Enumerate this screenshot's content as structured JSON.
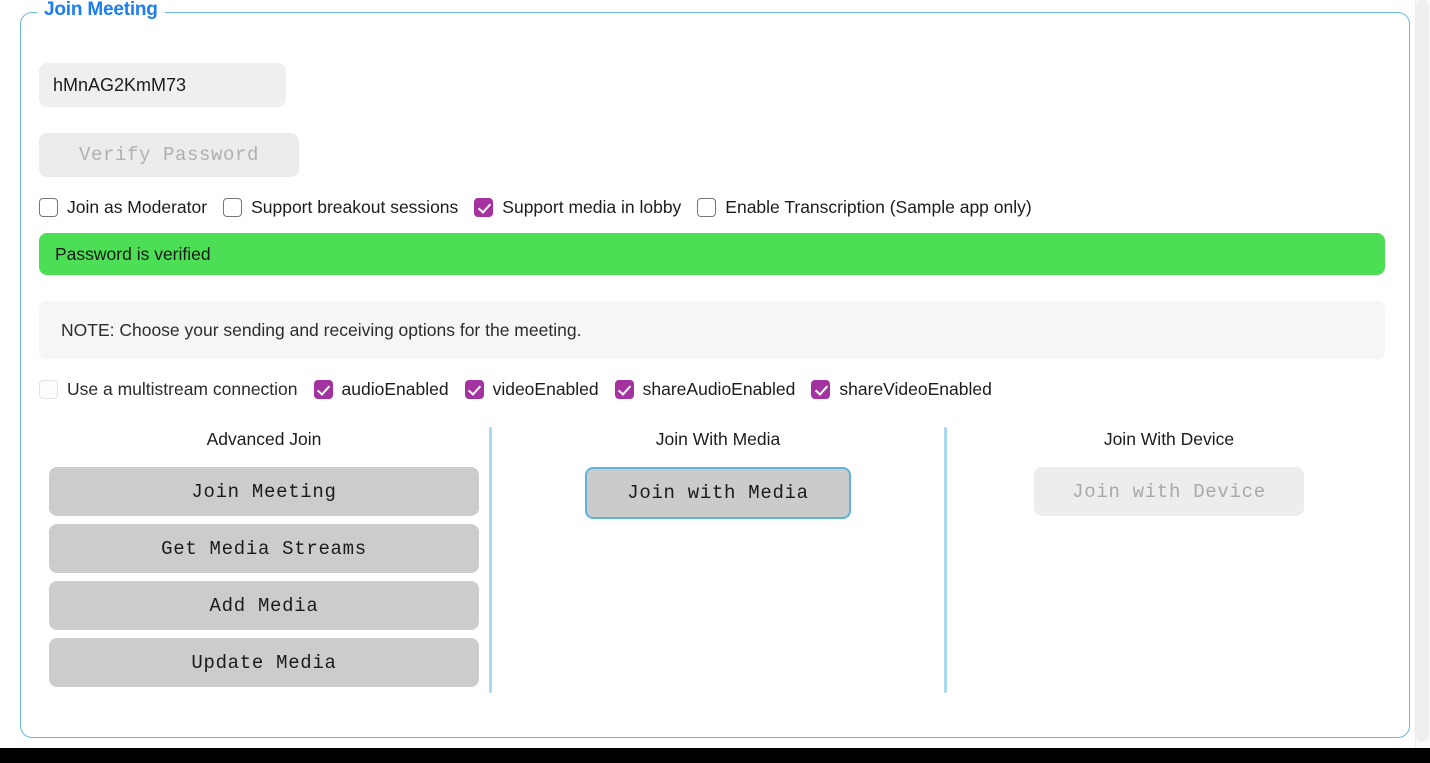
{
  "panel": {
    "legend": "Join Meeting"
  },
  "form": {
    "meeting_id_value": "hMnAG2KmM73",
    "meeting_id_placeholder": "",
    "verify_password_label": "Verify Password"
  },
  "options_row_1": [
    {
      "label": "Join as Moderator",
      "checked": false,
      "disabled": false
    },
    {
      "label": "Support breakout sessions",
      "checked": false,
      "disabled": false
    },
    {
      "label": "Support media in lobby",
      "checked": true,
      "disabled": false
    },
    {
      "label": "Enable Transcription (Sample app only)",
      "checked": false,
      "disabled": false
    }
  ],
  "status": {
    "message": "Password is verified",
    "color": "#4cde55"
  },
  "note": {
    "text": "NOTE: Choose your sending and receiving options for the meeting."
  },
  "options_row_2": [
    {
      "label": "Use a multistream connection",
      "checked": false,
      "disabled": true
    },
    {
      "label": "audioEnabled",
      "checked": true,
      "disabled": false
    },
    {
      "label": "videoEnabled",
      "checked": true,
      "disabled": false
    },
    {
      "label": "shareAudioEnabled",
      "checked": true,
      "disabled": false
    },
    {
      "label": "shareVideoEnabled",
      "checked": true,
      "disabled": false
    }
  ],
  "columns": {
    "advanced_join": {
      "title": "Advanced Join",
      "buttons": [
        {
          "label": "Join Meeting",
          "disabled": false
        },
        {
          "label": "Get Media Streams",
          "disabled": false
        },
        {
          "label": "Add Media",
          "disabled": false
        },
        {
          "label": "Update Media",
          "disabled": false
        }
      ]
    },
    "join_with_media": {
      "title": "Join With Media",
      "buttons": [
        {
          "label": "Join with Media",
          "disabled": false,
          "focused": true
        }
      ]
    },
    "join_with_device": {
      "title": "Join With Device",
      "buttons": [
        {
          "label": "Join with Device",
          "disabled": true
        }
      ]
    }
  },
  "colors": {
    "legend_blue": "#1d7df5",
    "panel_border": "#6cb6e3",
    "checkbox_checked": "#a4339f",
    "divider_blue": "#a9d9ed",
    "focus_ring": "#5cb4db",
    "status_green": "#4cde55"
  }
}
